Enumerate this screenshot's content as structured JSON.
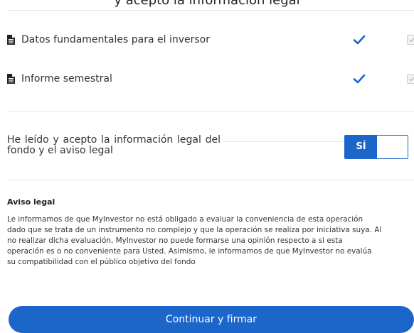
{
  "header": {
    "partial_text": "y acepto la información legal"
  },
  "documents": [
    {
      "label": "Datos fundamentales para el inversor"
    },
    {
      "label": "Informe semestral"
    }
  ],
  "legal_acceptance": {
    "label": "He leído y acepto la información legal del fondo y el aviso legal",
    "toggle_on_label": "SÍ"
  },
  "aviso_legal": {
    "heading": "Aviso legal",
    "lines": [
      "Le informamos de que MyInvestor no está obligado a evaluar la conveniencia de esta operación",
      "dado que se trata de un instrumento no complejo y que la operación se realiza por iniciativa suya. Al",
      "no realizar dicha evaluación, MyInvestor no puede formarse una opinión respecto a si esta",
      "operación es o no conveniente para Usted. Asimismo, le informamos de que MyInvestor no evalúa",
      "su compatibilidad con el público objetivo del fondo"
    ]
  },
  "actions": {
    "continue_label": "Continuar y firmar"
  },
  "colors": {
    "accent": "#1c65c9",
    "divider": "#e6e6e6"
  }
}
